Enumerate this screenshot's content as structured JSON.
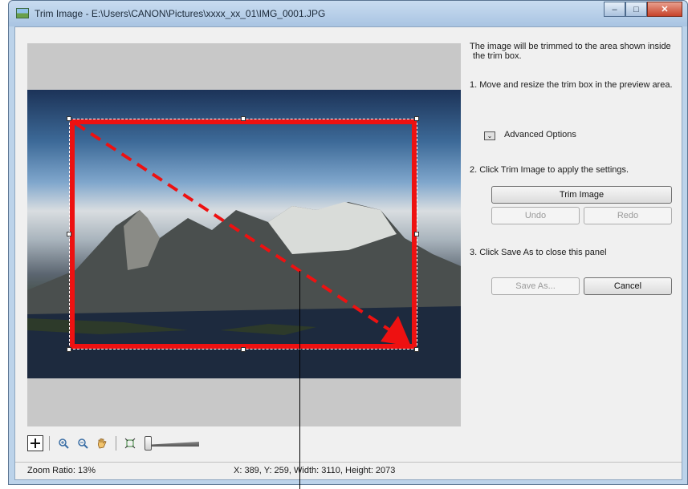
{
  "window": {
    "title": "Trim Image - E:\\Users\\CANON\\Pictures\\xxxx_xx_01\\IMG_0001.JPG",
    "minimize_glyph": "‒",
    "maximize_glyph": "□",
    "close_glyph": "✕"
  },
  "panel": {
    "intro": "The image will be trimmed to the area shown inside",
    "intro2": "the trim box.",
    "step1": "1.  Move and resize the trim box in the preview area.",
    "advanced_options": "Advanced Options",
    "step2": "2. Click Trim Image to apply the settings.",
    "trim_button": "Trim Image",
    "undo_button": "Undo",
    "redo_button": "Redo",
    "step3": "3. Click Save As to close this panel",
    "save_as_button": "Save As...",
    "cancel_button": "Cancel"
  },
  "toolbar": {
    "icons": [
      "trim-tool-icon",
      "zoom-in-icon",
      "zoom-out-icon",
      "hand-icon",
      "fit-to-window-icon"
    ]
  },
  "status": {
    "zoom_ratio": "Zoom Ratio: 13%",
    "coordinates": "X: 389, Y: 259, Width: 3110, Height: 2073"
  },
  "colors": {
    "trim_box": "#ee1111",
    "preview_bg": "#c8c8c8"
  }
}
